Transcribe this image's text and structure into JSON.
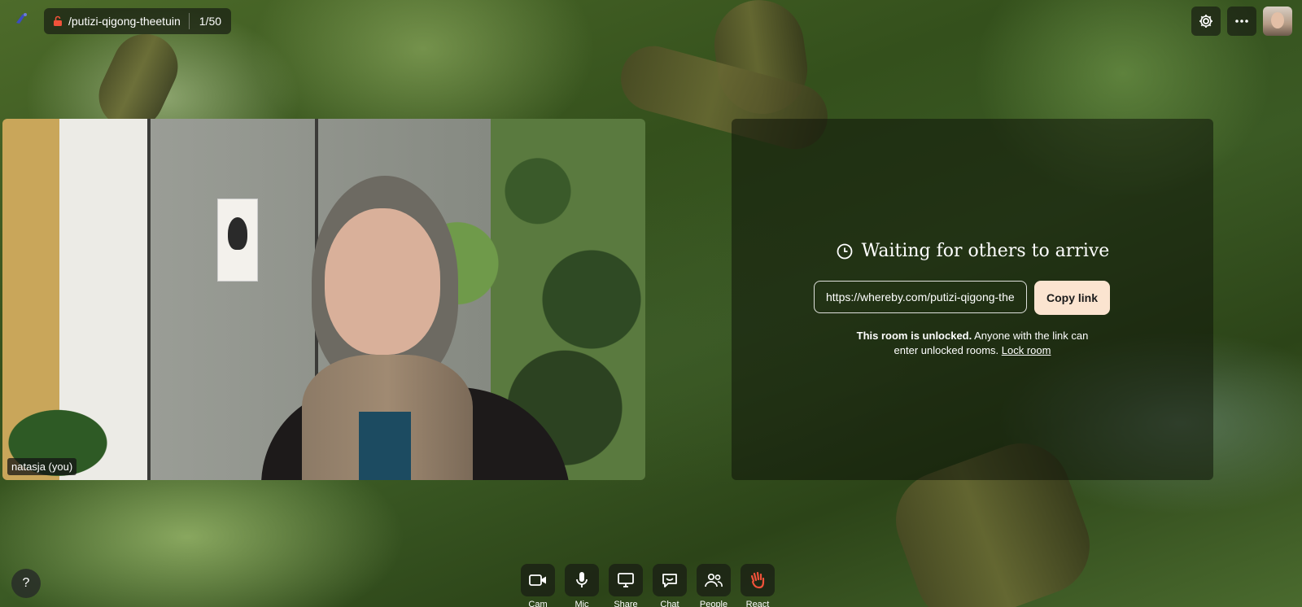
{
  "topbar": {
    "room_name": "/putizi-qigong-theetuin",
    "participant_count": "1/50"
  },
  "video": {
    "name_label": "natasja (you)"
  },
  "waiting": {
    "title": "Waiting for others to arrive",
    "link_value": "https://whereby.com/putizi-qigong-theetuin",
    "copy_label": "Copy link",
    "unlock_bold": "This room is unlocked.",
    "unlock_line1": " Anyone with the link can",
    "unlock_line2": "enter unlocked rooms. ",
    "lock_room_label": "Lock room"
  },
  "help": {
    "label": "?"
  },
  "controls": [
    {
      "label": "Cam",
      "icon": "camera-icon"
    },
    {
      "label": "Mic",
      "icon": "microphone-icon"
    },
    {
      "label": "Share",
      "icon": "screen-share-icon"
    },
    {
      "label": "Chat",
      "icon": "chat-icon"
    },
    {
      "label": "People",
      "icon": "people-icon"
    },
    {
      "label": "React",
      "icon": "raise-hand-icon"
    }
  ],
  "colors": {
    "copy_button_bg": "#fbe4d0",
    "lock_icon": "#f0523a",
    "hand_icon": "#f0523a"
  }
}
